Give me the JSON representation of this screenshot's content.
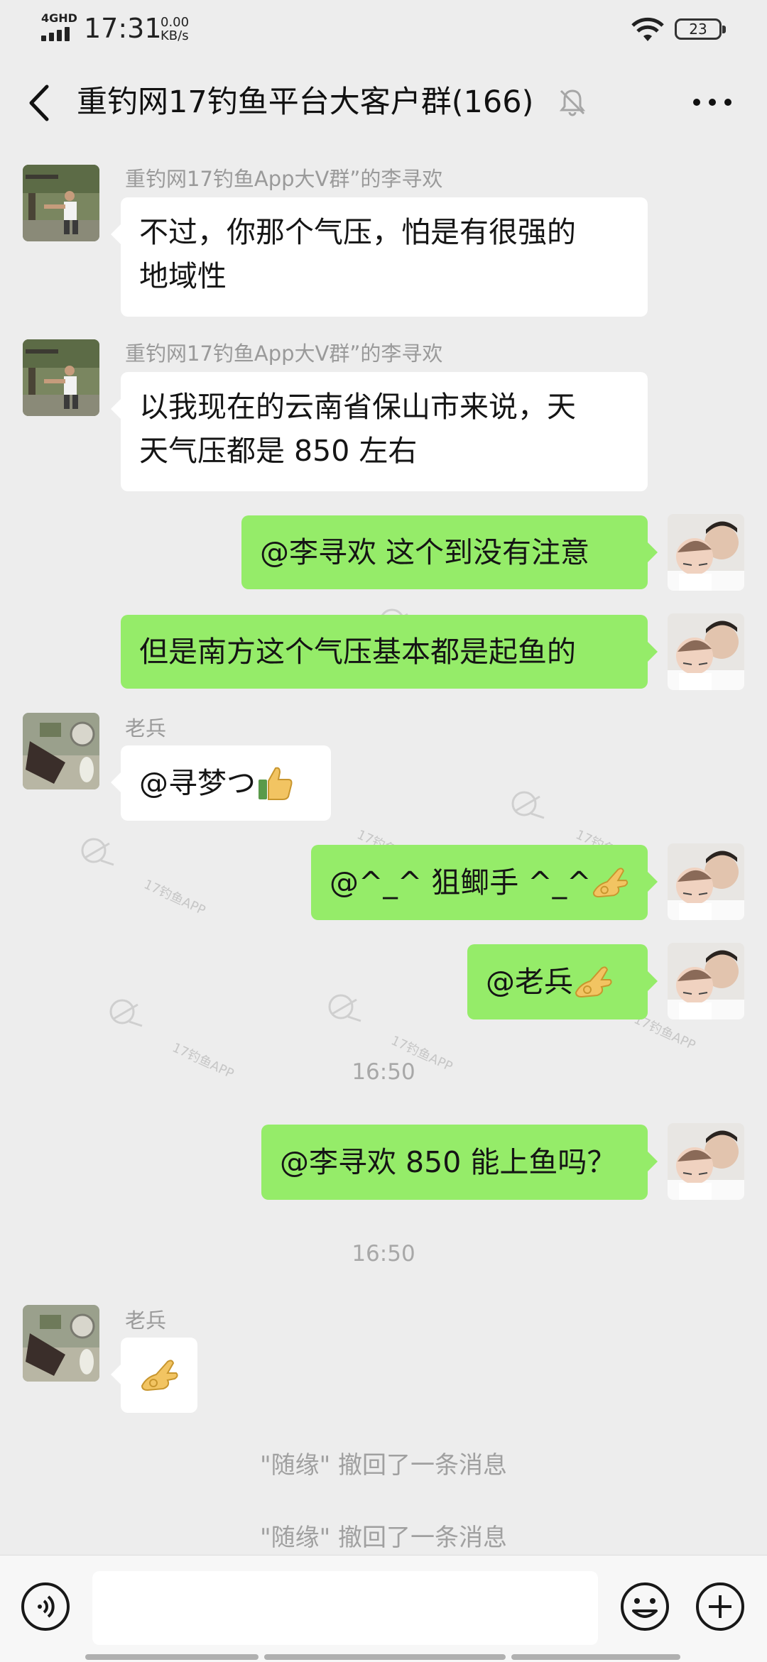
{
  "status_bar": {
    "network": "4GHD",
    "time": "17:31",
    "speed_value": "0.00",
    "speed_unit": "KB/s",
    "battery": "23"
  },
  "header": {
    "title": "重钓网17钓鱼平台大客户群(166)"
  },
  "messages": [
    {
      "sender": "重钓网17钓鱼App大V群”的李寻欢",
      "lines": [
        "不过，你那个气压，怕是有很强的",
        "地域性"
      ]
    },
    {
      "sender": "重钓网17钓鱼App大V群”的李寻欢",
      "lines": [
        "以我现在的云南省保山市来说，天",
        "天气压都是 850 左右"
      ]
    },
    {
      "text": "@李寻欢  这个到没有注意"
    },
    {
      "text": "但是南方这个气压基本都是起鱼的"
    },
    {
      "sender": "老兵",
      "text": "@寻梦つ "
    },
    {
      "text": "@^_^ 狙鲫手 ^_^ "
    },
    {
      "text": "@老兵"
    },
    {
      "text": "@李寻欢  850 能上鱼吗？"
    },
    {
      "sender": "老兵"
    }
  ],
  "timestamps": [
    "16:50",
    "16:50"
  ],
  "system_messages": [
    "\"随缘\" 撤回了一条消息",
    "\"随缘\" 撤回了一条消息"
  ],
  "watermark_text": "17钓鱼APP",
  "icons": {
    "back": "chevron-left-icon",
    "mute": "bell-off-icon",
    "more": "more-dots-icon",
    "voice": "voice-icon",
    "emoji": "smile-icon",
    "plus": "plus-circle-icon",
    "thumbs_up": "thumbs-up-emoji",
    "ok_hand": "ok-hand-emoji"
  },
  "colors": {
    "background": "#ededed",
    "sent_bubble": "#95ec69",
    "received_bubble": "#ffffff"
  }
}
